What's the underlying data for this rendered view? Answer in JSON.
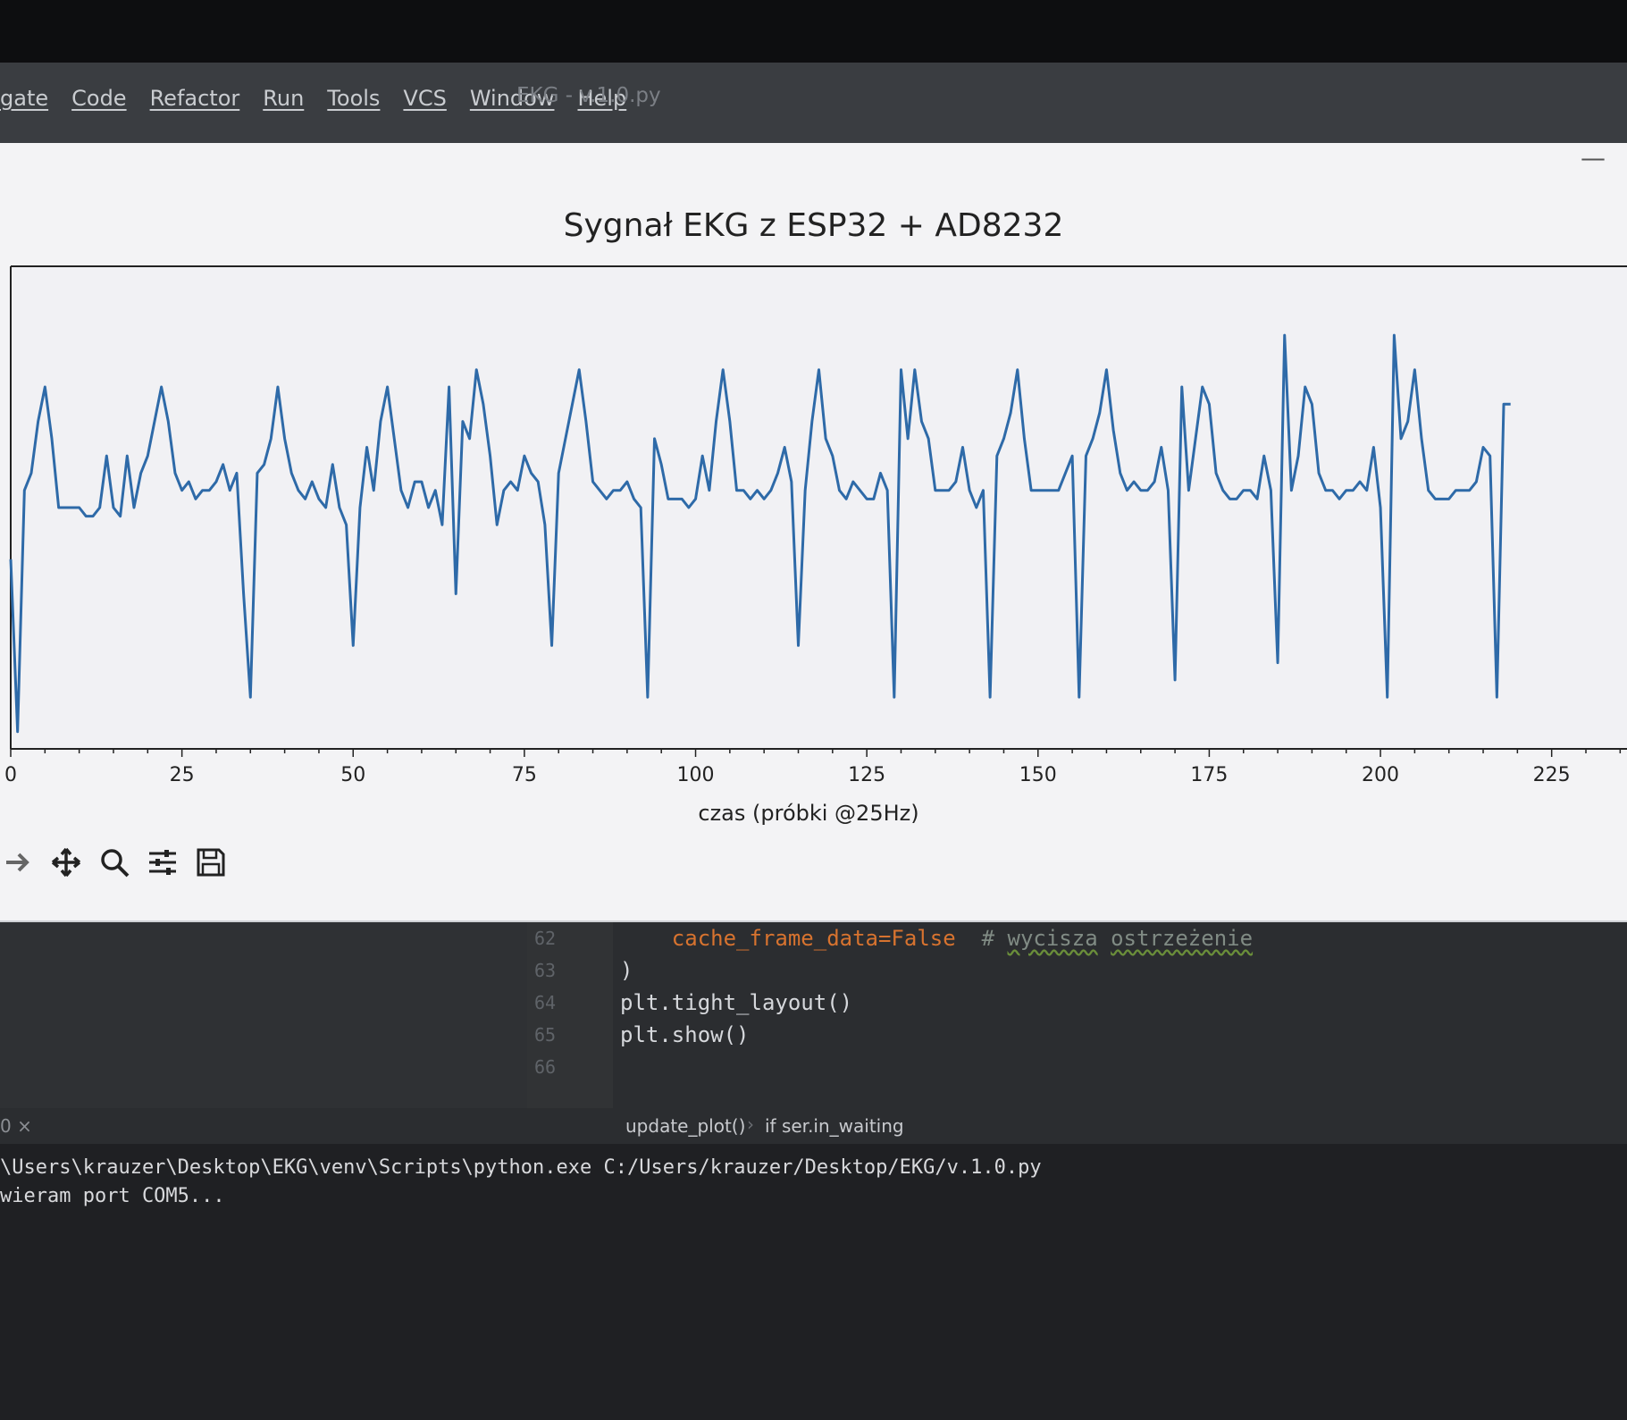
{
  "menu": {
    "items": [
      "gate",
      "Code",
      "Refactor",
      "Run",
      "Tools",
      "VCS",
      "Window",
      "Help"
    ],
    "window_title": "EKG - v.1.0.py"
  },
  "plot_window": {
    "minimize_glyph": "—",
    "toolbar_icons": [
      "forward-icon",
      "pan-icon",
      "zoom-icon",
      "configure-subplots-icon",
      "save-icon"
    ]
  },
  "chart_data": {
    "type": "line",
    "title": "Sygnał EKG z ESP32 + AD8232",
    "xlabel": "czas (próbki @25Hz)",
    "ylabel": "",
    "xlim": [
      0,
      236
    ],
    "ylim": [
      -1.2,
      1.6
    ],
    "xticks": [
      0,
      25,
      50,
      75,
      100,
      125,
      150,
      175,
      200,
      225
    ],
    "grid": true,
    "color": "#2e6aa8",
    "grid_color": "#d9a3a3",
    "series": [
      {
        "values": [
          -0.1,
          -1.1,
          0.3,
          0.4,
          0.7,
          0.9,
          0.6,
          0.2,
          0.2,
          0.2,
          0.2,
          0.15,
          0.15,
          0.2,
          0.5,
          0.2,
          0.15,
          0.5,
          0.2,
          0.4,
          0.5,
          0.7,
          0.9,
          0.7,
          0.4,
          0.3,
          0.35,
          0.25,
          0.3,
          0.3,
          0.35,
          0.45,
          0.3,
          0.4,
          -0.3,
          -0.9,
          0.4,
          0.45,
          0.6,
          0.9,
          0.6,
          0.4,
          0.3,
          0.25,
          0.35,
          0.25,
          0.2,
          0.45,
          0.2,
          0.1,
          -0.6,
          0.2,
          0.55,
          0.3,
          0.7,
          0.9,
          0.6,
          0.3,
          0.2,
          0.35,
          0.35,
          0.2,
          0.3,
          0.1,
          0.9,
          -0.3,
          0.7,
          0.6,
          1.0,
          0.8,
          0.5,
          0.1,
          0.3,
          0.35,
          0.3,
          0.5,
          0.4,
          0.35,
          0.1,
          -0.6,
          0.4,
          0.6,
          0.8,
          1.0,
          0.7,
          0.35,
          0.3,
          0.25,
          0.3,
          0.3,
          0.35,
          0.25,
          0.2,
          -0.9,
          0.6,
          0.45,
          0.25,
          0.25,
          0.25,
          0.2,
          0.25,
          0.5,
          0.3,
          0.7,
          1.0,
          0.7,
          0.3,
          0.3,
          0.25,
          0.3,
          0.25,
          0.3,
          0.4,
          0.55,
          0.35,
          -0.6,
          0.3,
          0.7,
          1.0,
          0.6,
          0.5,
          0.3,
          0.25,
          0.35,
          0.3,
          0.25,
          0.25,
          0.4,
          0.3,
          -0.9,
          1.0,
          0.6,
          1.0,
          0.7,
          0.6,
          0.3,
          0.3,
          0.3,
          0.35,
          0.55,
          0.3,
          0.2,
          0.3,
          -0.9,
          0.5,
          0.6,
          0.75,
          1.0,
          0.6,
          0.3,
          0.3,
          0.3,
          0.3,
          0.3,
          0.4,
          0.5,
          -0.9,
          0.5,
          0.6,
          0.75,
          1.0,
          0.65,
          0.4,
          0.3,
          0.35,
          0.3,
          0.3,
          0.35,
          0.55,
          0.3,
          -0.8,
          0.9,
          0.3,
          0.6,
          0.9,
          0.8,
          0.4,
          0.3,
          0.25,
          0.25,
          0.3,
          0.3,
          0.25,
          0.5,
          0.3,
          -0.7,
          1.2,
          0.3,
          0.5,
          0.9,
          0.8,
          0.4,
          0.3,
          0.3,
          0.25,
          0.3,
          0.3,
          0.35,
          0.3,
          0.55,
          0.2,
          -0.9,
          1.2,
          0.6,
          0.7,
          1.0,
          0.6,
          0.3,
          0.25,
          0.25,
          0.25,
          0.3,
          0.3,
          0.3,
          0.35,
          0.55,
          0.5,
          -0.9,
          0.8,
          0.8
        ],
        "x_step": 1
      }
    ]
  },
  "editor": {
    "line_numbers": [
      "62",
      "63",
      "64",
      "65",
      "66"
    ],
    "code_lines": [
      {
        "kw": "cache_frame_data=False",
        "gap": "  ",
        "comment_hash": "# ",
        "comment_a": "wycisza",
        "space": " ",
        "comment_b": "ostrzeżenie"
      },
      {
        "text": ")"
      },
      {
        "text": "plt.tight_layout()"
      },
      {
        "text": "plt.show()"
      },
      {
        "text": ""
      }
    ],
    "tab_label": "0 ×",
    "breadcrumb": [
      "update_plot()",
      "if ser.in_waiting"
    ],
    "breadcrumb_sep": "›"
  },
  "console": {
    "lines": [
      "\\Users\\krauzer\\Desktop\\EKG\\venv\\Scripts\\python.exe C:/Users/krauzer/Desktop/EKG/v.1.0.py",
      "wieram port COM5..."
    ]
  }
}
